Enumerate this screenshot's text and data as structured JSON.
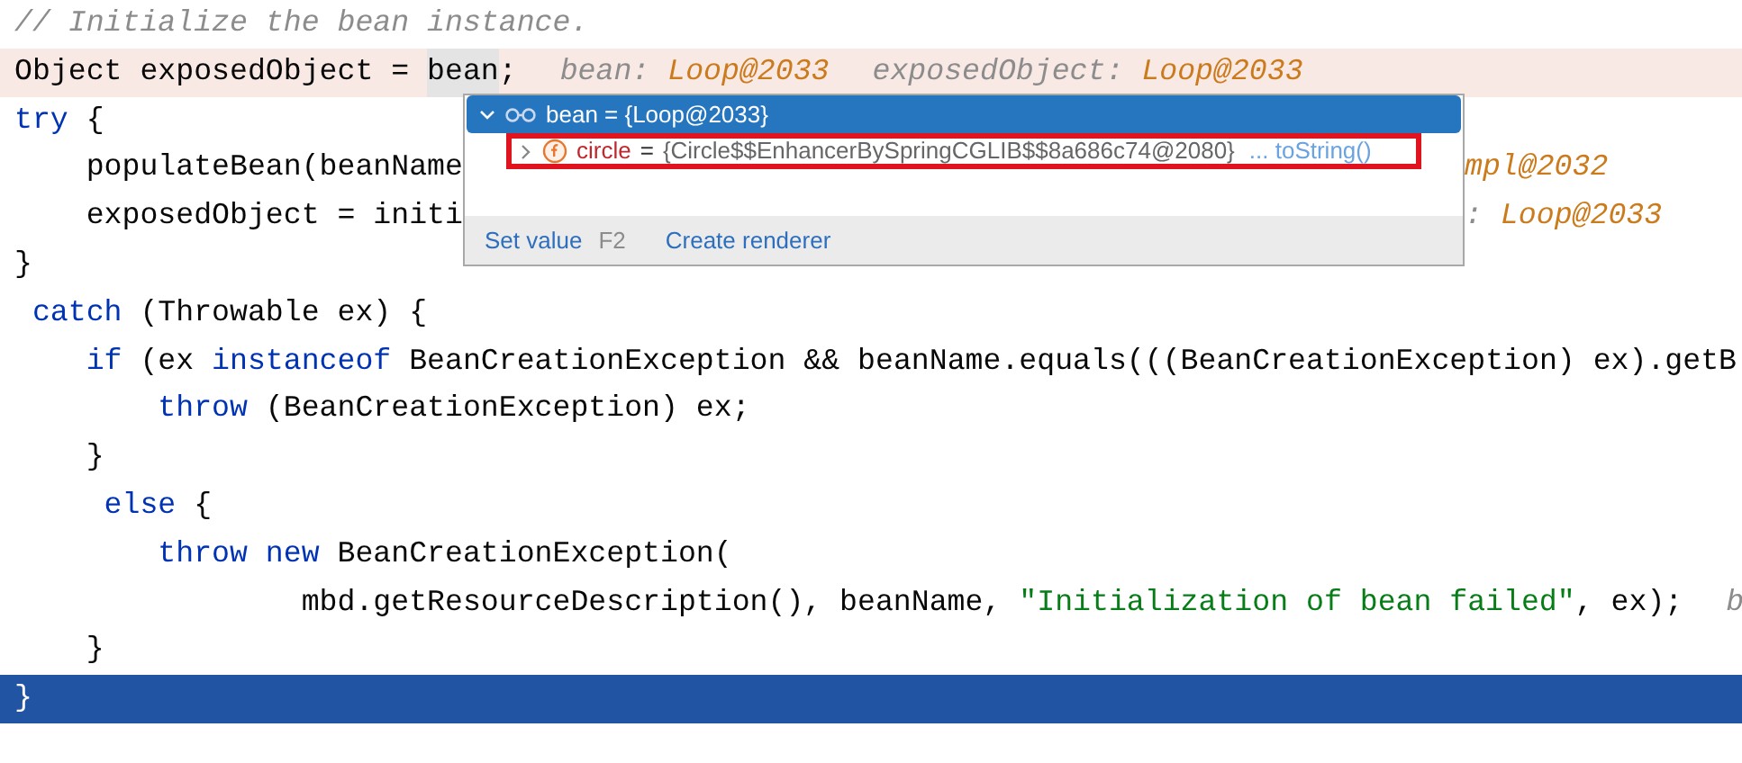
{
  "editor": {
    "lines": [
      {
        "kind": "normal",
        "segments": [
          [
            {
              "text": "// Initialize the bean instance.",
              "kind": "comment"
            }
          ]
        ]
      },
      {
        "kind": "execution",
        "segments": [
          [
            {
              "text": "Object exposedObject = ",
              "kind": "plain"
            },
            {
              "text": "bean",
              "kind": "usage"
            },
            {
              "text": ";",
              "kind": "plain"
            },
            {
              "text": "bean:",
              "kind": "hint_label"
            },
            {
              "text": "Loop@2033",
              "kind": "hint_value"
            },
            {
              "text": "exposedObject:",
              "kind": "hint_label"
            },
            {
              "text": "Loop@2033",
              "kind": "hint_value"
            }
          ]
        ]
      },
      {
        "kind": "normal",
        "segments": [
          [
            {
              "text": "try",
              "kind": "keyword"
            },
            {
              "text": " {",
              "kind": "plain"
            }
          ]
        ]
      },
      {
        "kind": "normal",
        "segments": [
          [
            {
              "text": "    populateBean(beanName",
              "kind": "plain"
            }
          ],
          [
            {
              "text": "mpl@2032",
              "kind": "hint_value"
            }
          ]
        ]
      },
      {
        "kind": "normal",
        "segments": [
          [
            {
              "text": "    exposedObject = initi",
              "kind": "plain"
            }
          ],
          [
            {
              "text": ":",
              "kind": "hint_label"
            },
            {
              "text": "Loop@2033",
              "kind": "hint_value"
            }
          ]
        ]
      },
      {
        "kind": "normal",
        "segments": [
          [
            {
              "text": "}",
              "kind": "plain"
            }
          ]
        ]
      },
      {
        "kind": "normal",
        "segments": [
          [
            {
              "text": " catch",
              "kind": "keyword"
            },
            {
              "text": " (Throwable ex) {",
              "kind": "plain"
            }
          ]
        ]
      },
      {
        "kind": "normal",
        "segments": [
          [
            {
              "text": "    if",
              "kind": "keyword"
            },
            {
              "text": " (ex ",
              "kind": "plain"
            },
            {
              "text": "instanceof",
              "kind": "keyword"
            },
            {
              "text": " BeanCreationException && beanName.equals(((BeanCreationException) ex).getB",
              "kind": "plain"
            }
          ]
        ]
      },
      {
        "kind": "normal",
        "segments": [
          [
            {
              "text": "        throw",
              "kind": "keyword"
            },
            {
              "text": " (BeanCreationException) ex;",
              "kind": "plain"
            }
          ]
        ]
      },
      {
        "kind": "normal",
        "segments": [
          [
            {
              "text": "    }",
              "kind": "plain"
            }
          ]
        ]
      },
      {
        "kind": "normal",
        "segments": [
          [
            {
              "text": "     else",
              "kind": "keyword"
            },
            {
              "text": " {",
              "kind": "plain"
            }
          ]
        ]
      },
      {
        "kind": "normal",
        "segments": [
          [
            {
              "text": "        throw new",
              "kind": "keyword"
            },
            {
              "text": " BeanCreationException(",
              "kind": "plain"
            }
          ]
        ]
      },
      {
        "kind": "normal",
        "segments": [
          [
            {
              "text": "                mbd.getResourceDescription(), beanName, ",
              "kind": "plain"
            },
            {
              "text": "\"Initialization of bean failed\"",
              "kind": "string"
            },
            {
              "text": ", ex);",
              "kind": "plain"
            },
            {
              "text": "b",
              "kind": "hint_label"
            }
          ]
        ]
      },
      {
        "kind": "normal",
        "segments": [
          [
            {
              "text": "    }",
              "kind": "plain"
            }
          ]
        ]
      },
      {
        "kind": "selected",
        "segments": [
          [
            {
              "text": "}",
              "kind": "plain"
            }
          ]
        ]
      }
    ]
  },
  "popup": {
    "root": {
      "text": "bean = {Loop@2033}",
      "expanded": true,
      "selected": true
    },
    "children": [
      {
        "name": "circle",
        "sign": "=",
        "value": "{Circle$$EnhancerBySpringCGLIB$$8a686c74@2080}",
        "link": "... toString()",
        "expanded": false,
        "highlighted": true
      }
    ],
    "footer": [
      {
        "label": "Set value",
        "shortcut": "F2"
      },
      {
        "label": "Create renderer"
      }
    ]
  }
}
